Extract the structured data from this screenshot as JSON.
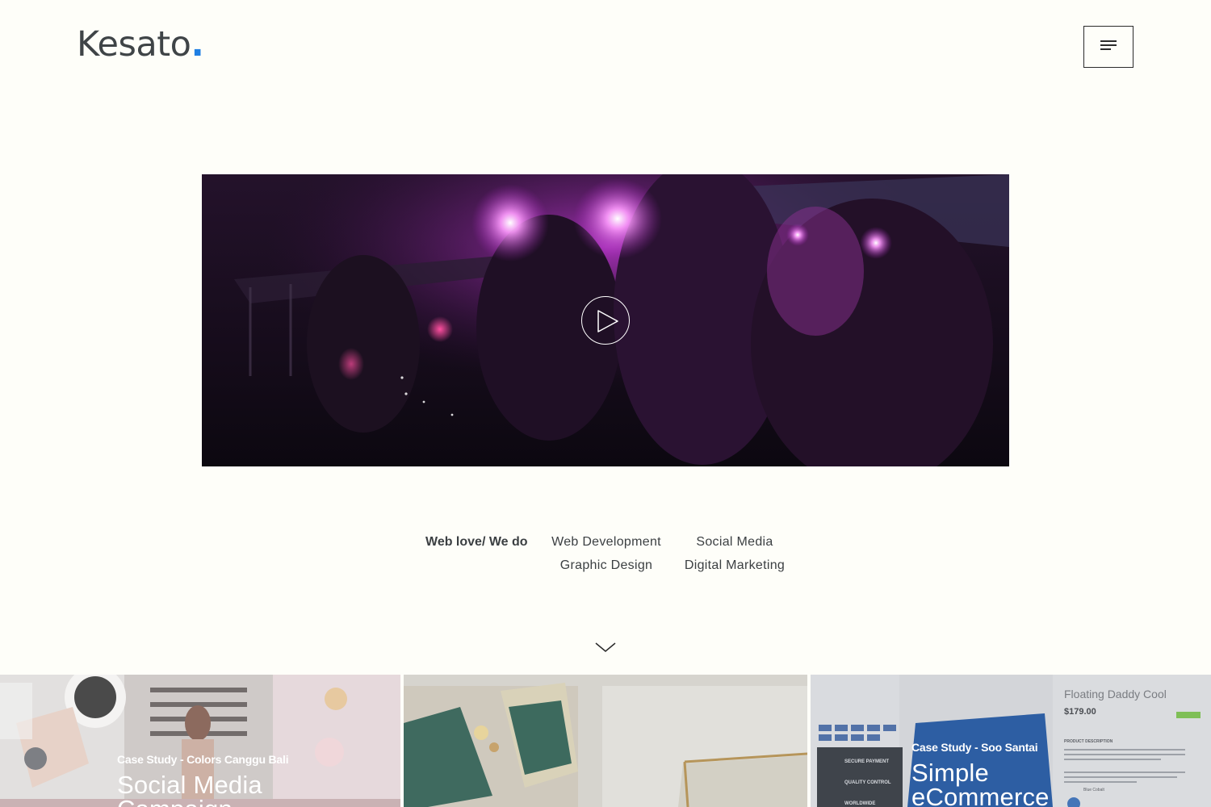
{
  "header": {
    "logo_text": "Kesato",
    "logo_dot": ".",
    "menu_icon": "hamburger-icon"
  },
  "hero_video": {
    "play_icon": "play-icon"
  },
  "services": {
    "label": "Web love/ We do",
    "items": [
      "Web Development",
      "Social Media",
      "Graphic Design",
      "Digital Marketing"
    ]
  },
  "scroll_icon": "chevron-down-icon",
  "case_studies": [
    {
      "kicker": "Case Study - Colors Canggu Bali",
      "title_line1": "Social Media",
      "title_line2": "Campaign"
    },
    {
      "kicker": "",
      "title_line1": "",
      "title_line2": ""
    },
    {
      "kicker": "Case Study - Soo Santai",
      "title_line1": "Simple",
      "title_line2": "eCommerce"
    }
  ],
  "tile3_mock": {
    "product_name": "Floating Daddy Cool",
    "price": "$179.00",
    "secure": "SECURE PAYMENT",
    "quality": "QUALITY CONTROL",
    "worldwide": "WORLDWIDE",
    "description_label": "PRODUCT DESCRIPTION",
    "color_label": "Blue Cobalt"
  },
  "colors": {
    "background": "#fefef9",
    "accent": "#1f7fe3",
    "text": "#3f4447"
  }
}
